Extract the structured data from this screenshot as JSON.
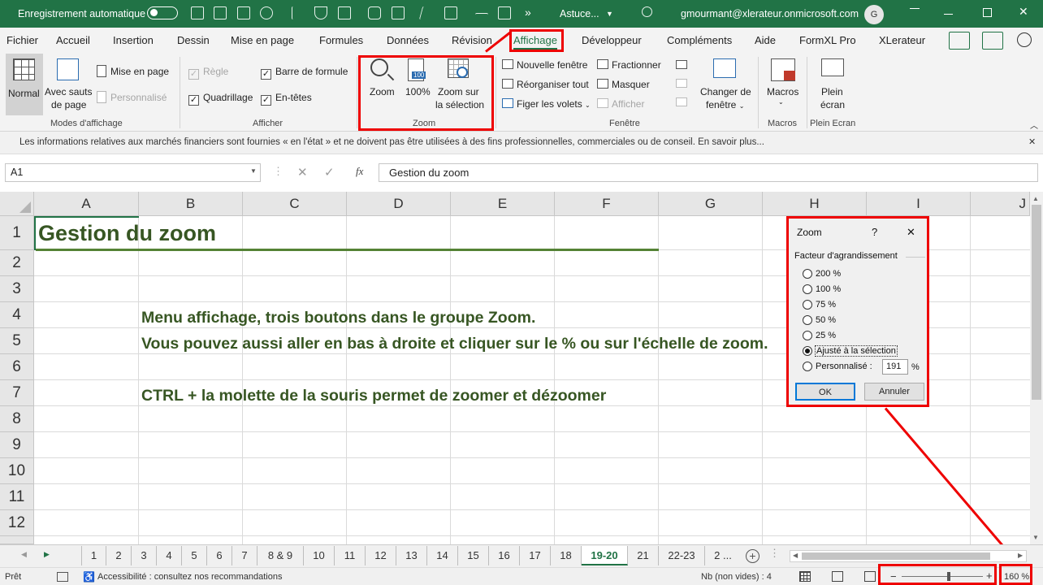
{
  "titlebar": {
    "autosave_label": "Enregistrement automatique",
    "file": "Astuce...",
    "account": "gmourmant@xlerateur.onmicrosoft.com",
    "avatar": "G"
  },
  "tabs": [
    "Fichier",
    "Accueil",
    "Insertion",
    "Dessin",
    "Mise en page",
    "Formules",
    "Données",
    "Révision",
    "Affichage",
    "Développeur",
    "Compléments",
    "Aide",
    "FormXL Pro",
    "XLerateur"
  ],
  "ribbon": {
    "modes": {
      "normal": "Normal",
      "page_break_1": "Avec sauts",
      "page_break_2": "de page",
      "page_layout": "Mise en page",
      "custom": "Personnalisé",
      "group": "Modes d'affichage"
    },
    "show": {
      "ruler": "Règle",
      "gridlines": "Quadrillage",
      "formula_bar": "Barre de formule",
      "headings": "En-têtes",
      "group": "Afficher"
    },
    "zoom": {
      "zoom": "Zoom",
      "hundred": "100%",
      "hundred_icon": "100",
      "selection_1": "Zoom sur",
      "selection_2": "la sélection",
      "group": "Zoom"
    },
    "window": {
      "new": "Nouvelle fenêtre",
      "arrange": "Réorganiser tout",
      "freeze": "Figer les volets",
      "split": "Fractionner",
      "hide": "Masquer",
      "unhide": "Afficher",
      "switch_1": "Changer de",
      "switch_2": "fenêtre",
      "group": "Fenêtre"
    },
    "macros": {
      "label": "Macros",
      "group": "Macros"
    },
    "fullscreen": {
      "label_1": "Plein",
      "label_2": "écran",
      "group": "Plein Ecran"
    }
  },
  "infobar": "Les informations relatives aux marchés financiers sont fournies « en l'état » et ne doivent pas être utilisées à des fins professionnelles, commerciales ou de conseil. En savoir plus...",
  "namebox": "A1",
  "formula": "Gestion du zoom",
  "columns": [
    "A",
    "B",
    "C",
    "D",
    "E",
    "F",
    "G",
    "H",
    "I",
    "J"
  ],
  "rows": [
    "1",
    "2",
    "3",
    "4",
    "5",
    "6",
    "7",
    "8",
    "9",
    "10",
    "11",
    "12"
  ],
  "cells": {
    "a1": "Gestion du zoom",
    "b4": "Menu affichage, trois boutons dans le groupe Zoom.",
    "b5": "Vous pouvez aussi aller en bas à droite et cliquer sur le % ou sur l'échelle de zoom.",
    "b7": "CTRL + la molette de la souris permet de zoomer et dézoomer"
  },
  "dialog": {
    "title": "Zoom",
    "help": "?",
    "close": "✕",
    "section": "Facteur d'agrandissement",
    "options": [
      "200 %",
      "100 %",
      "75 %",
      "50 %",
      "25 %",
      "Ajusté à la sélection",
      "Personnalisé :"
    ],
    "selected_index": 5,
    "custom_value": "191",
    "custom_unit": "%",
    "ok": "OK",
    "cancel": "Annuler"
  },
  "sheets": [
    "1",
    "2",
    "3",
    "4",
    "5",
    "6",
    "7",
    "8 & 9",
    "10",
    "11",
    "12",
    "13",
    "14",
    "15",
    "16",
    "17",
    "18",
    "19-20",
    "21",
    "22-23",
    "2 ..."
  ],
  "active_sheet": "19-20",
  "status": {
    "ready": "Prêt",
    "accessibility": "Accessibilité : consultez nos recommandations",
    "count": "Nb (non vides) : 4",
    "zoom": "160 %",
    "zoom_minus": "−",
    "zoom_plus": "+"
  },
  "colors": {
    "excel_green": "#217346",
    "cell_text": "#375623",
    "highlight": "#e00000",
    "title_underline": "#548235"
  }
}
